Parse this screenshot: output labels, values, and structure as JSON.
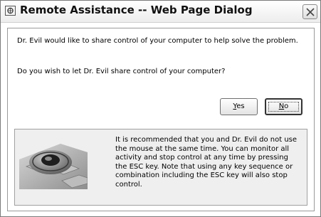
{
  "window": {
    "title": "Remote Assistance -- Web Page Dialog",
    "close_icon": "close-icon"
  },
  "dialog": {
    "message": "Dr. Evil would like to share control of your computer to help solve the problem.",
    "question": "Do you wish to let Dr. Evil share control of your computer?",
    "buttons": {
      "yes_mnemonic": "Y",
      "yes_rest": "es",
      "no_mnemonic": "N",
      "no_rest": "o"
    },
    "info": {
      "image_icon": "keyboard-mouse-illustration",
      "text": "It is recommended that you and Dr. Evil do not use the mouse at the same time. You can monitor all activity and stop control at any time by pressing the ESC key. Note that using any key sequence or combination including the ESC key will also stop control."
    }
  }
}
